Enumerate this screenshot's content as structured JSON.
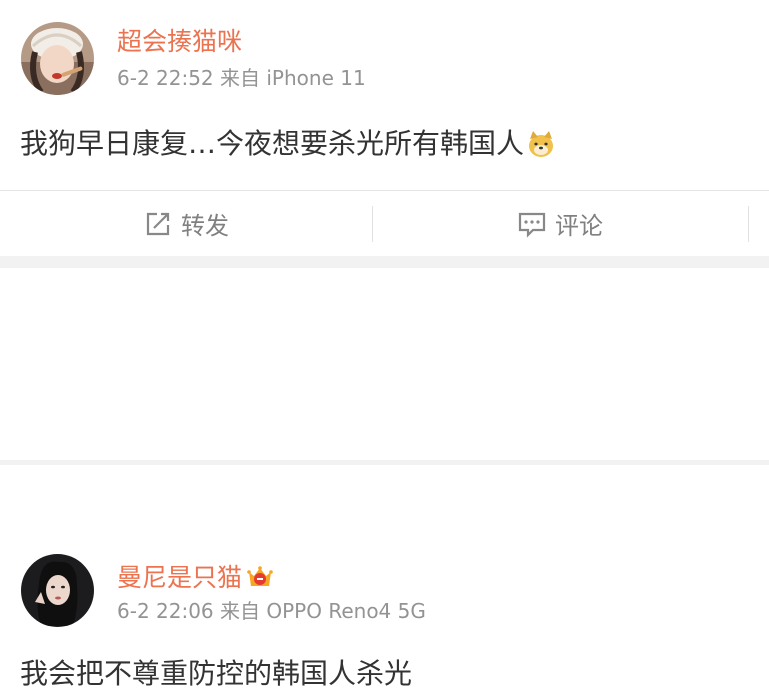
{
  "posts": [
    {
      "username": "超会揍猫咪",
      "meta": "6-2 22:52 来自 iPhone 11",
      "content": "我狗早日康复…今夜想要杀光所有韩国人",
      "emoji": "doge-emoji",
      "actions": {
        "repost_label": "转发",
        "comment_label": "评论"
      }
    },
    {
      "username": "曼尼是只猫",
      "badge": "crown-vip-icon",
      "meta": "6-2 22:06 来自 OPPO Reno4 5G",
      "content": "我会把不尊重防控的韩国人杀光"
    }
  ],
  "colors": {
    "username": "#eb7350",
    "meta": "#939393",
    "content": "#333333",
    "action": "#808080",
    "separator": "#f2f2f2"
  }
}
